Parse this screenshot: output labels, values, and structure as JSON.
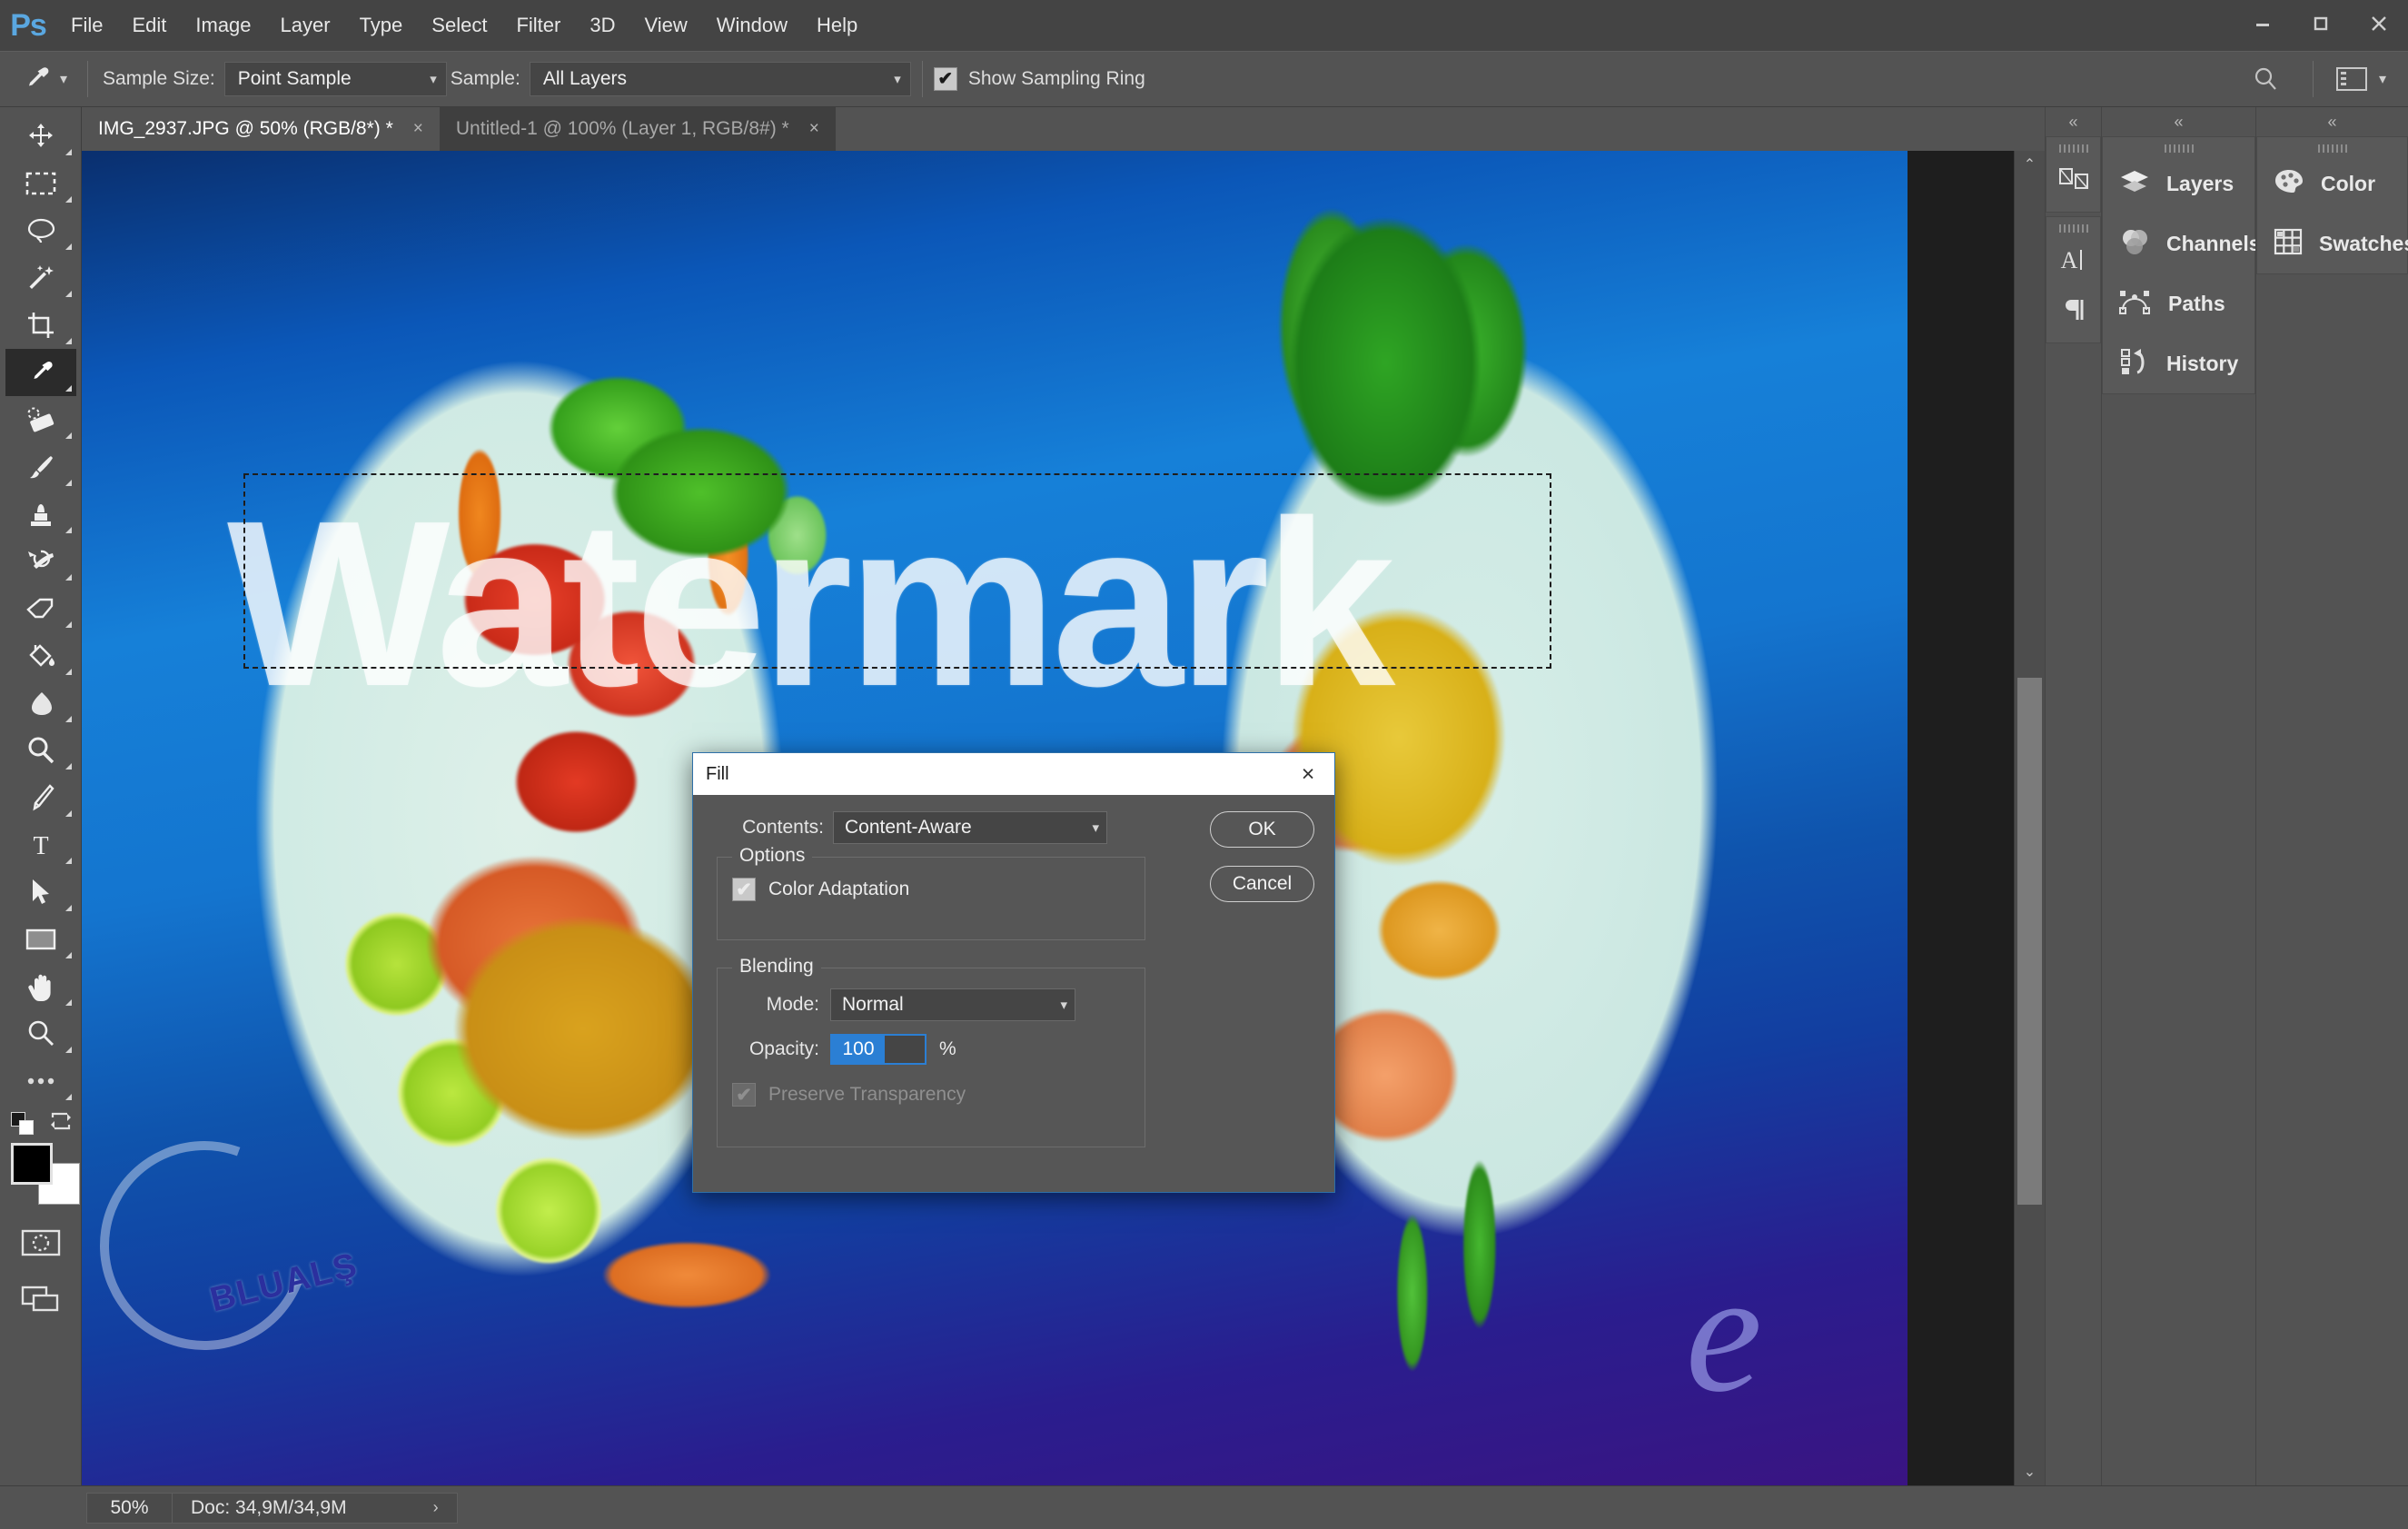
{
  "app": {
    "logo": "Ps",
    "menus": [
      "File",
      "Edit",
      "Image",
      "Layer",
      "Type",
      "Select",
      "Filter",
      "3D",
      "View",
      "Window",
      "Help"
    ],
    "window_controls": {
      "minimize": "minimize-icon",
      "maximize": "maximize-icon",
      "close": "close-icon"
    }
  },
  "options_bar": {
    "tool_icon": "eyedropper-icon",
    "sample_size_label": "Sample Size:",
    "sample_size_value": "Point Sample",
    "sample_label": "Sample:",
    "sample_value": "All Layers",
    "show_sampling_ring_label": "Show Sampling Ring",
    "show_sampling_ring_checked": true,
    "search_icon": "search-icon",
    "workspace_icon": "workspace-icon"
  },
  "tabs": [
    {
      "label": "IMG_2937.JPG @ 50% (RGB/8*) *",
      "active": true,
      "close": "×"
    },
    {
      "label": "Untitled-1 @ 100% (Layer 1, RGB/8#) *",
      "active": false,
      "close": "×"
    }
  ],
  "toolbar": {
    "tools": [
      {
        "name": "move-tool",
        "selected": false
      },
      {
        "name": "rectangular-marquee-tool",
        "selected": false
      },
      {
        "name": "lasso-tool",
        "selected": false
      },
      {
        "name": "magic-wand-tool",
        "selected": false
      },
      {
        "name": "crop-tool",
        "selected": false
      },
      {
        "name": "eyedropper-tool",
        "selected": true
      },
      {
        "name": "spot-healing-brush-tool",
        "selected": false
      },
      {
        "name": "brush-tool",
        "selected": false
      },
      {
        "name": "clone-stamp-tool",
        "selected": false
      },
      {
        "name": "history-brush-tool",
        "selected": false
      },
      {
        "name": "eraser-tool",
        "selected": false
      },
      {
        "name": "paint-bucket-tool",
        "selected": false
      },
      {
        "name": "blur-tool",
        "selected": false
      },
      {
        "name": "dodge-tool",
        "selected": false
      },
      {
        "name": "pen-tool",
        "selected": false
      },
      {
        "name": "type-tool",
        "selected": false
      },
      {
        "name": "path-selection-tool",
        "selected": false
      },
      {
        "name": "rectangle-tool",
        "selected": false
      },
      {
        "name": "hand-tool",
        "selected": false
      },
      {
        "name": "zoom-tool",
        "selected": false
      },
      {
        "name": "edit-toolbar-tool",
        "selected": false
      }
    ],
    "foreground_color": "#000000",
    "background_color": "#ffffff",
    "quick_mask": "quick-mask-icon",
    "screen_mode": "screen-mode-icon"
  },
  "canvas": {
    "watermark_text": "Watermark",
    "brand_text": "BLUALŞ",
    "brand_letter": "e",
    "has_selection": true
  },
  "dock": {
    "collapse_glyph": "«",
    "mini_buttons": [
      {
        "name": "libraries-icon"
      },
      {
        "name": "character-icon"
      },
      {
        "name": "paragraph-icon"
      }
    ],
    "panel_group_1": [
      {
        "label": "Layers",
        "icon": "layers-icon"
      },
      {
        "label": "Channels",
        "icon": "channels-icon"
      },
      {
        "label": "Paths",
        "icon": "paths-icon"
      },
      {
        "label": "History",
        "icon": "history-icon"
      }
    ],
    "panel_group_2": [
      {
        "label": "Color",
        "icon": "color-palette-icon"
      },
      {
        "label": "Swatches",
        "icon": "swatches-grid-icon"
      }
    ]
  },
  "dialog": {
    "title": "Fill",
    "close_glyph": "×",
    "contents_label": "Contents:",
    "contents_value": "Content-Aware",
    "ok_label": "OK",
    "cancel_label": "Cancel",
    "options_legend": "Options",
    "color_adaptation_label": "Color Adaptation",
    "color_adaptation_checked": true,
    "blending_legend": "Blending",
    "mode_label": "Mode:",
    "mode_value": "Normal",
    "opacity_label": "Opacity:",
    "opacity_value": "100",
    "percent_symbol": "%",
    "preserve_transparency_label": "Preserve Transparency",
    "preserve_transparency_checked": false,
    "accent_color": "#2b7fd4"
  },
  "status_bar": {
    "zoom": "50%",
    "doc_info": "Doc: 34,9M/34,9M",
    "expand_glyph": "›",
    "collapse_glyph": "‹"
  },
  "scrollbars": {
    "up_glyph": "⌃",
    "down_glyph": "⌄",
    "left_glyph": "‹",
    "right_glyph": "›"
  }
}
